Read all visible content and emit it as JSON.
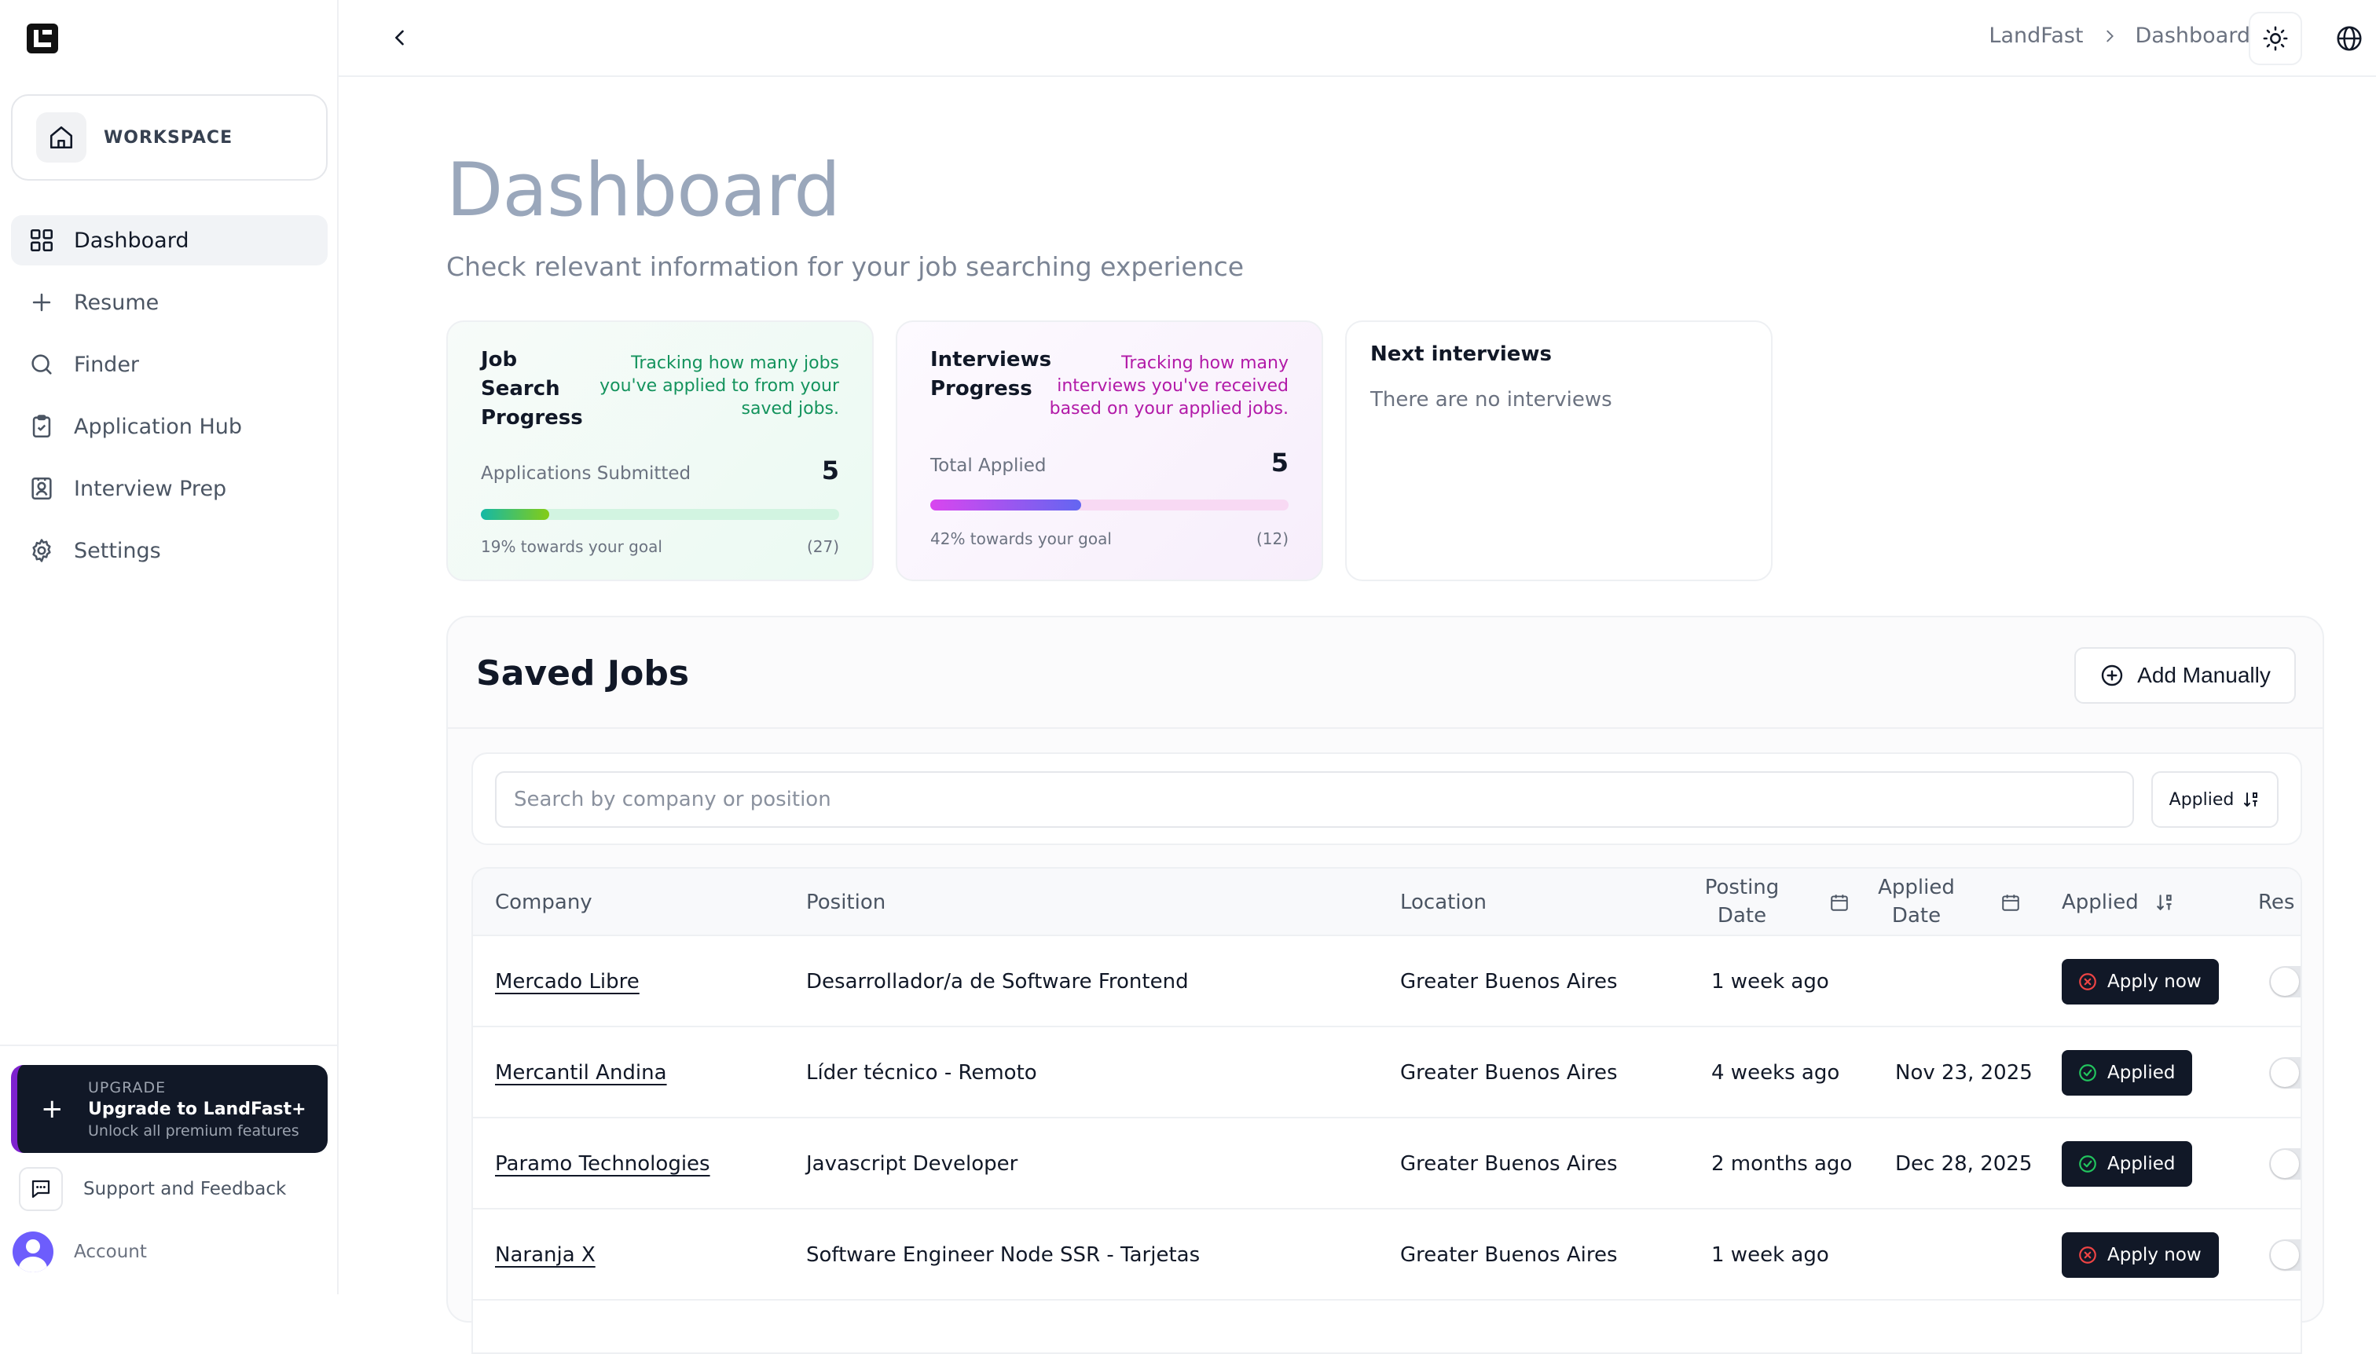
{
  "sidebar": {
    "workspace_label": "WORKSPACE",
    "items": [
      {
        "label": "Dashboard",
        "icon": "grid-icon",
        "active": true
      },
      {
        "label": "Resume",
        "icon": "plus-icon"
      },
      {
        "label": "Finder",
        "icon": "search-icon"
      },
      {
        "label": "Application Hub",
        "icon": "clipboard-check-icon"
      },
      {
        "label": "Interview Prep",
        "icon": "contact-card-icon"
      },
      {
        "label": "Settings",
        "icon": "gear-icon"
      }
    ],
    "upgrade": {
      "eyebrow": "UPGRADE",
      "title": "Upgrade to LandFast+",
      "subtitle": "Unlock all premium features"
    },
    "support_label": "Support and Feedback",
    "account_label": "Account"
  },
  "topbar": {
    "breadcrumb": [
      "LandFast",
      "Dashboard"
    ]
  },
  "page": {
    "title": "Dashboard",
    "subtitle": "Check relevant information for your job searching experience"
  },
  "cards": {
    "job_search": {
      "title": "Job Search Progress",
      "description": "Tracking how many jobs you've applied to from your saved jobs.",
      "metric_label": "Applications Submitted",
      "metric_value": "5",
      "progress": 0.19,
      "goal_text": "19% towards your goal",
      "goal_target": "(27)"
    },
    "interviews": {
      "title": "Interviews Progress",
      "description": "Tracking how many interviews you've received based on your applied jobs.",
      "metric_label": "Total Applied",
      "metric_value": "5",
      "progress": 0.42,
      "goal_text": "42% towards your goal",
      "goal_target": "(12)"
    },
    "next_interviews": {
      "title": "Next interviews",
      "empty_text": "There are no interviews"
    }
  },
  "saved_jobs": {
    "title": "Saved Jobs",
    "add_label": "Add Manually",
    "search_placeholder": "Search by company or position",
    "sort_label": "Applied",
    "columns": {
      "company": "Company",
      "position": "Position",
      "location": "Location",
      "posting_date": "Posting Date",
      "applied_date": "Applied Date",
      "applied": "Applied",
      "res": "Res"
    },
    "rows": [
      {
        "company": "Mercado Libre",
        "position": "Desarrollador/a de Software Frontend",
        "location": "Greater Buenos Aires",
        "posting_date": "1 week ago",
        "applied_date": "",
        "status": "Apply now",
        "status_kind": "apply"
      },
      {
        "company": "Mercantil Andina",
        "position": "Líder técnico - Remoto",
        "location": "Greater Buenos Aires",
        "posting_date": "4 weeks ago",
        "applied_date": "Nov 23, 2025",
        "status": "Applied",
        "status_kind": "applied"
      },
      {
        "company": "Paramo Technologies",
        "position": "Javascript Developer",
        "location": "Greater Buenos Aires",
        "posting_date": "2 months ago",
        "applied_date": "Dec 28, 2025",
        "status": "Applied",
        "status_kind": "applied"
      },
      {
        "company": "Naranja X",
        "position": "Software Engineer Node SSR - Tarjetas",
        "location": "Greater Buenos Aires",
        "posting_date": "1 week ago",
        "applied_date": "",
        "status": "Apply now",
        "status_kind": "apply"
      }
    ]
  },
  "colors": {
    "accent_green": "#14935d",
    "accent_magenta": "#b21aa8",
    "dark_button": "#111827",
    "status_red": "#ef4444",
    "status_green": "#22c55e"
  }
}
